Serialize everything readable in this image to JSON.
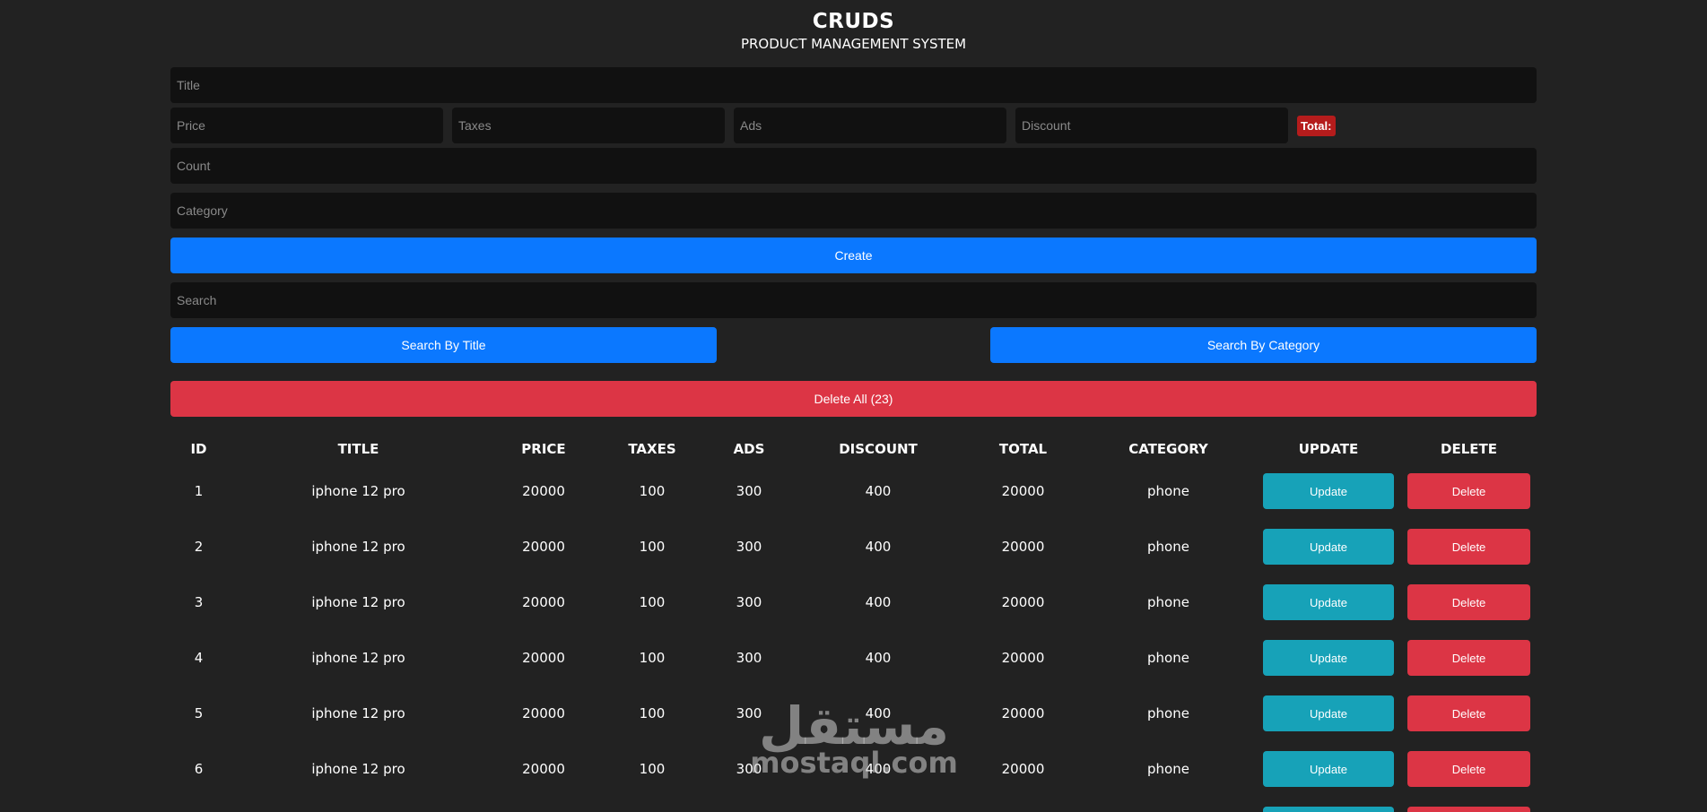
{
  "header": {
    "title": "CRUDS",
    "subtitle": "PRODUCT MANAGEMENT SYSTEM"
  },
  "form": {
    "title_placeholder": "Title",
    "price_placeholder": "Price",
    "taxes_placeholder": "Taxes",
    "ads_placeholder": "Ads",
    "discount_placeholder": "Discount",
    "total_label": "Total:",
    "count_placeholder": "Count",
    "category_placeholder": "Category",
    "create_label": "Create"
  },
  "search": {
    "placeholder": "Search",
    "by_title_label": "Search By Title",
    "by_category_label": "Search By Category"
  },
  "delete_all_label": "Delete All (23)",
  "table": {
    "headers": [
      "ID",
      "TITLE",
      "PRICE",
      "TAXES",
      "ADS",
      "DISCOUNT",
      "TOTAL",
      "CATEGORY",
      "UPDATE",
      "DELETE"
    ],
    "update_label": "Update",
    "delete_label": "Delete",
    "rows": [
      {
        "id": "1",
        "title": "iphone 12 pro",
        "price": "20000",
        "taxes": "100",
        "ads": "300",
        "discount": "400",
        "total": "20000",
        "category": "phone"
      },
      {
        "id": "2",
        "title": "iphone 12 pro",
        "price": "20000",
        "taxes": "100",
        "ads": "300",
        "discount": "400",
        "total": "20000",
        "category": "phone"
      },
      {
        "id": "3",
        "title": "iphone 12 pro",
        "price": "20000",
        "taxes": "100",
        "ads": "300",
        "discount": "400",
        "total": "20000",
        "category": "phone"
      },
      {
        "id": "4",
        "title": "iphone 12 pro",
        "price": "20000",
        "taxes": "100",
        "ads": "300",
        "discount": "400",
        "total": "20000",
        "category": "phone"
      },
      {
        "id": "5",
        "title": "iphone 12 pro",
        "price": "20000",
        "taxes": "100",
        "ads": "300",
        "discount": "400",
        "total": "20000",
        "category": "phone"
      },
      {
        "id": "6",
        "title": "iphone 12 pro",
        "price": "20000",
        "taxes": "100",
        "ads": "300",
        "discount": "400",
        "total": "20000",
        "category": "phone"
      },
      {
        "id": "",
        "title": "",
        "price": "",
        "taxes": "",
        "ads": "",
        "discount": "",
        "total": "",
        "category": ""
      }
    ]
  },
  "watermark": {
    "arabic": "مستقل",
    "latin": "mostaql.com"
  },
  "colors": {
    "background": "#222222",
    "input_bg": "#111111",
    "primary": "#0b78ff",
    "danger": "#dc3545",
    "info": "#17a2b8",
    "total_badge": "#b51c1c"
  }
}
